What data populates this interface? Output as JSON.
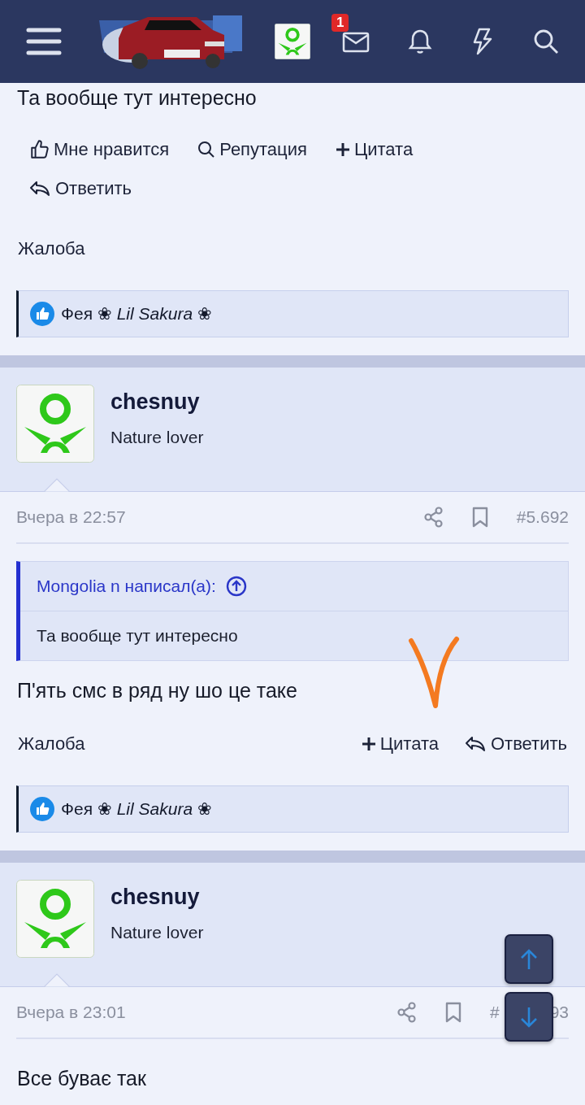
{
  "header": {
    "notification_count": "1"
  },
  "posts": [
    {
      "kind": "partial",
      "message": "Та вообще тут интересно",
      "actions": [
        {
          "kind": "like",
          "label": "Мне нравится"
        },
        {
          "kind": "reputation",
          "label": "Репутация"
        },
        {
          "kind": "quote",
          "label": "Цитата"
        },
        {
          "kind": "reply",
          "label": "Ответить"
        }
      ],
      "report": "Жалоба",
      "reactions": "Фея ❀ *Lil Sakura* ❀"
    },
    {
      "kind": "full",
      "author": "chesnuy",
      "user_title": "Nature lover",
      "date": "Вчера в 22:57",
      "number": "#5.692",
      "quote": {
        "author": "Mongolia n написал(а):",
        "text": "Та вообще тут интересно"
      },
      "message": "П'ять смс в ряд ну шо це таке",
      "report": "Жалоба",
      "actions": [
        {
          "kind": "quote",
          "label": "Цитата"
        },
        {
          "kind": "reply",
          "label": "Ответить"
        }
      ],
      "reactions": "Фея ❀ *Lil Sakura* ❀",
      "annotated": true
    },
    {
      "kind": "full",
      "author": "chesnuy",
      "user_title": "Nature lover",
      "date": "Вчера в 23:01",
      "number": "#",
      "number_suffix": "93",
      "message": "Все буває так"
    }
  ]
}
